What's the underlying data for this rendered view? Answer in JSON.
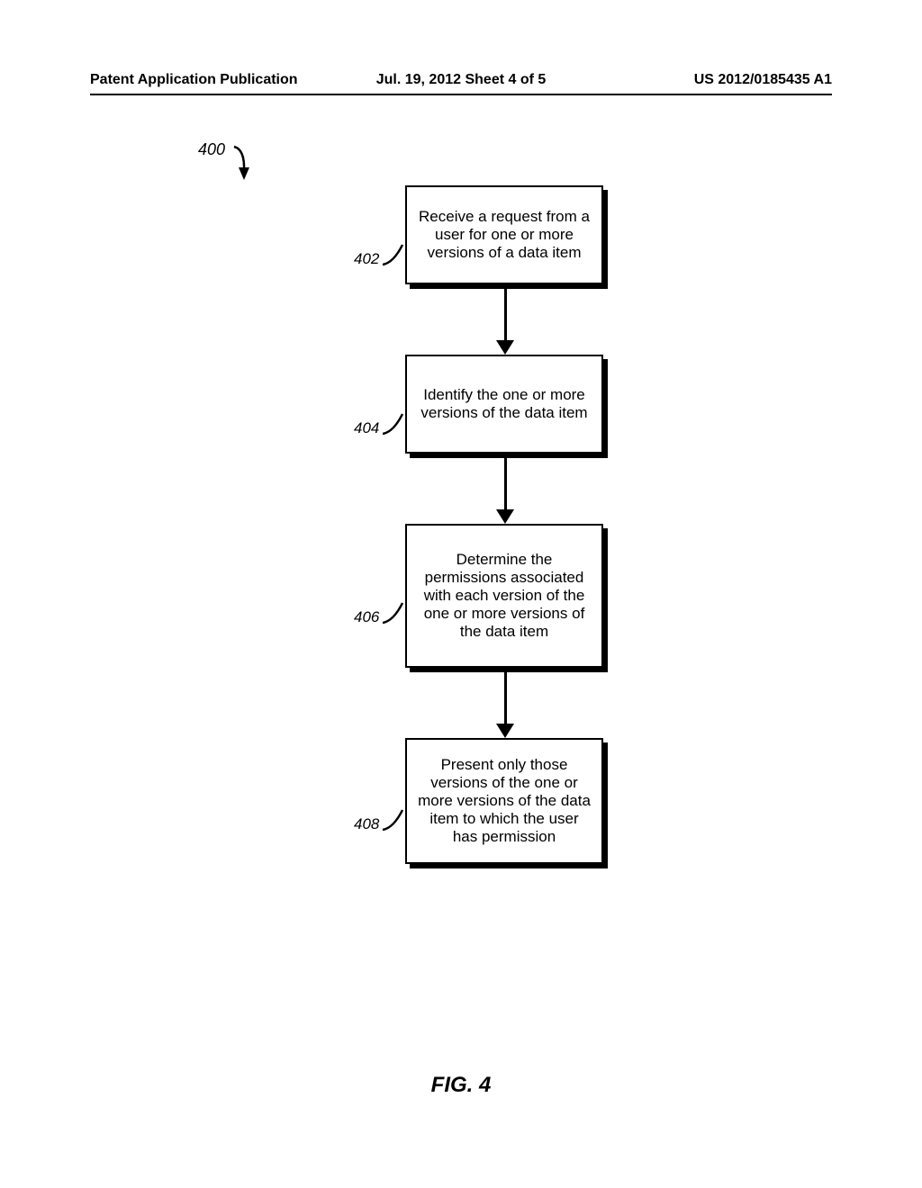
{
  "header": {
    "left": "Patent Application Publication",
    "center": "Jul. 19, 2012  Sheet 4 of 5",
    "right": "US 2012/0185435 A1"
  },
  "diagram": {
    "flow_id": "400",
    "steps": [
      {
        "num": "402",
        "text": "Receive a request from a user for one or more versions of a data item"
      },
      {
        "num": "404",
        "text": "Identify the one or more versions of the data item"
      },
      {
        "num": "406",
        "text": "Determine the permissions associated with each version of the one or more versions of the data item"
      },
      {
        "num": "408",
        "text": "Present only those versions of the one or more versions of the data item to which the user has permission"
      }
    ]
  },
  "figure_label": "FIG. 4"
}
